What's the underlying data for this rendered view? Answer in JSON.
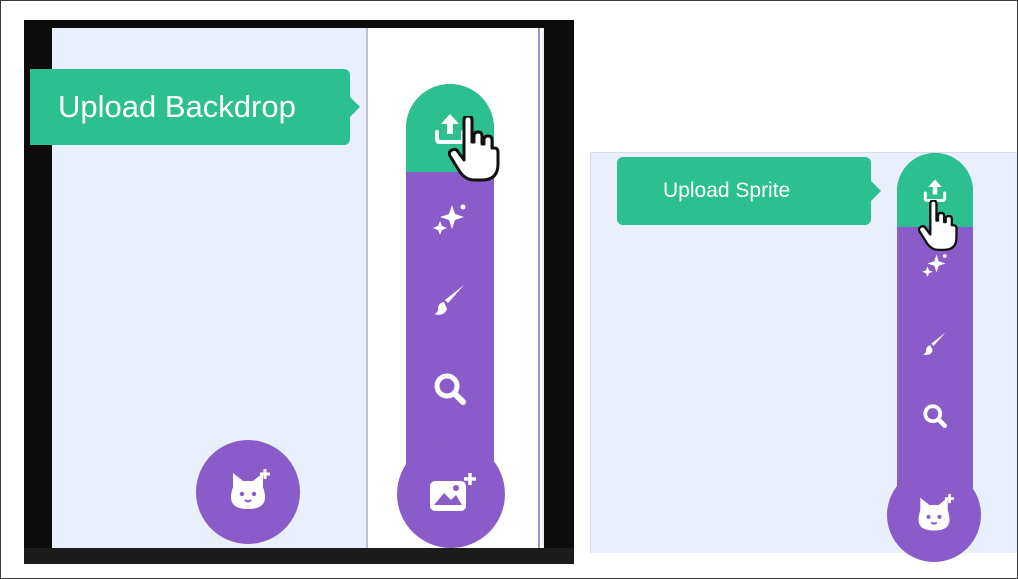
{
  "left_panel": {
    "tooltip": "Upload Backdrop",
    "menu_icons": [
      "upload-icon",
      "sparkle-icon",
      "paintbrush-icon",
      "search-icon"
    ],
    "bottom_buttons": [
      "choose-sprite-cat-icon",
      "choose-backdrop-image-icon"
    ]
  },
  "right_panel": {
    "tooltip": "Upload Sprite",
    "menu_icons": [
      "upload-icon",
      "sparkle-icon",
      "paintbrush-icon",
      "search-icon"
    ],
    "bottom_button": "choose-sprite-cat-icon"
  },
  "colors": {
    "accent_green": "#2cbf90",
    "menu_purple": "#8a5cc9",
    "stage_background": "#e9f0fb"
  }
}
